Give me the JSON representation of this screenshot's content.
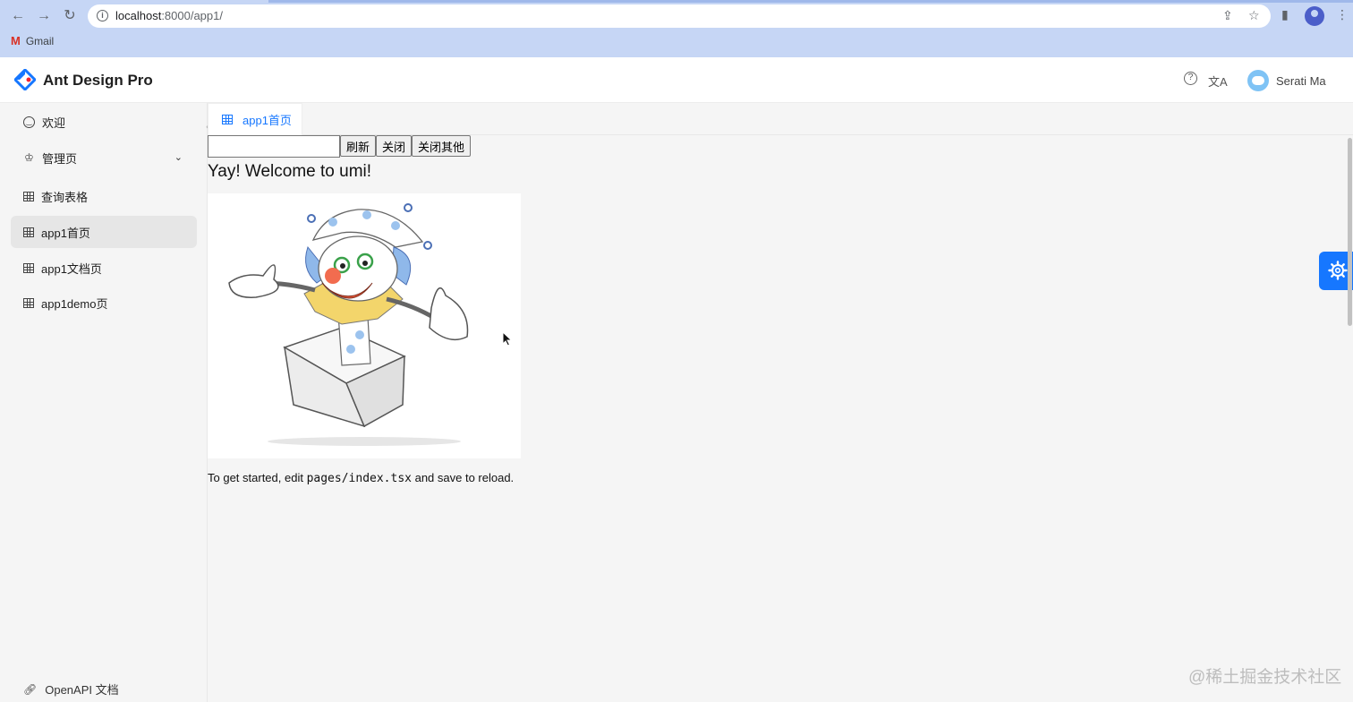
{
  "browser": {
    "url_host": "localhost",
    "url_path": ":8000/app1/",
    "bookmark": "Gmail",
    "bookmark_icon": "M"
  },
  "header": {
    "title": "Ant Design Pro",
    "help_icon": "?",
    "lang_icon": "文A",
    "user_name": "Serati Ma",
    "brand_color": "#1677ff"
  },
  "sidebar": {
    "items": [
      {
        "label": "欢迎",
        "icon": "smile-icon"
      },
      {
        "label": "管理页",
        "icon": "crown-icon",
        "chevron": "⌄"
      },
      {
        "label": "查询表格",
        "icon": "table-icon"
      },
      {
        "label": "app1首页",
        "icon": "table-icon",
        "active": true
      },
      {
        "label": "app1文档页",
        "icon": "table-icon"
      },
      {
        "label": "app1demo页",
        "icon": "table-icon"
      }
    ],
    "footer_link": "OpenAPI 文档"
  },
  "tabs": [
    {
      "label": "app1首页",
      "active": true
    }
  ],
  "toolbar": {
    "input_value": "",
    "refresh": "刷新",
    "close": "关闭",
    "close_others": "关闭其他"
  },
  "content": {
    "welcome": "Yay! Welcome to umi!",
    "hint_before": "To get started, edit ",
    "hint_code": "pages/index.tsx",
    "hint_after": " and save to reload."
  },
  "watermark": "@稀土掘金技术社区"
}
